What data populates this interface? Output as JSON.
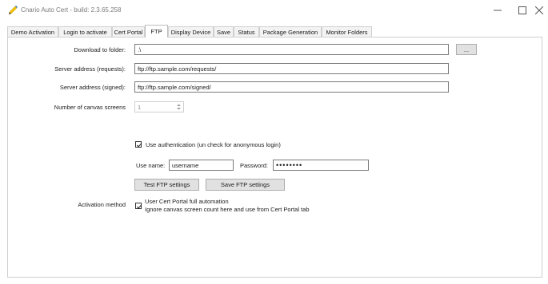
{
  "window": {
    "title": "Cnario Auto Cert - build: 2.3.65.258"
  },
  "tabs": [
    {
      "label": "Demo Activation"
    },
    {
      "label": "Login to activate"
    },
    {
      "label": "Cert Portal"
    },
    {
      "label": "FTP",
      "active": true
    },
    {
      "label": "Display Device"
    },
    {
      "label": "Save"
    },
    {
      "label": "Status"
    },
    {
      "label": "Package Generation"
    },
    {
      "label": "Monitor Folders"
    }
  ],
  "ftp": {
    "download_folder_label": "Download to folder:",
    "download_folder_value": ".\\",
    "browse_label": "...",
    "server_requests_label": "Server address (requests):",
    "server_requests_value": "ftp://ftp.sample.com/requests/",
    "server_signed_label": "Server address (signed):",
    "server_signed_value": "ftp://ftp.sample.com/signed/",
    "canvas_screens_label": "Number of canvas screens",
    "canvas_screens_value": "1",
    "use_auth_label": "Use authentication (un check for anonymous login)",
    "use_auth_checked": true,
    "username_label": "Use name:",
    "username_value": "username",
    "password_label": "Password:",
    "password_value": "password",
    "test_button_label": "Test FTP settings",
    "save_button_label": "Save FTP settings",
    "activation_method_label": "Activation method",
    "full_automation_label_line1": "User Cert Portal full automation",
    "full_automation_label_line2": "Ignore canvas screen count here and use from Cert Portal tab",
    "full_automation_checked": true
  },
  "icons": {
    "app": "pen-icon",
    "minimize": "minimize-icon",
    "maximize": "maximize-icon",
    "close": "close-icon"
  },
  "colors": {
    "app_icon_yellow": "#f2c200",
    "app_icon_blue": "#2a7fd4",
    "disabled_text": "#8a8a8a"
  }
}
